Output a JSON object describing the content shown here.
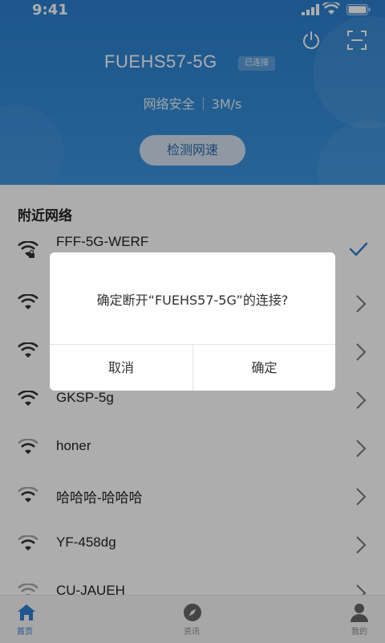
{
  "status_bar": {
    "time": "9:41"
  },
  "header": {
    "ssid": "FUEHS57-5G",
    "badge": "已连接",
    "security": "网络安全",
    "speed": "3M/s",
    "speed_test_button": "检测网速"
  },
  "nearby": {
    "title": "附近网络",
    "networks": [
      {
        "name": "FFF-5G-WERF",
        "locked": true,
        "connected": true
      },
      {
        "name": "",
        "locked": false,
        "connected": false
      },
      {
        "name": "",
        "locked": false,
        "connected": false
      },
      {
        "name": "GKSP-5g",
        "locked": false,
        "connected": false
      },
      {
        "name": "honer",
        "locked": false,
        "connected": false
      },
      {
        "name": "哈哈哈-哈哈哈",
        "locked": false,
        "connected": false
      },
      {
        "name": "YF-458dg",
        "locked": false,
        "connected": false
      },
      {
        "name": "CU-JAUEH",
        "locked": false,
        "connected": false
      }
    ]
  },
  "dialog": {
    "message": "确定断开“FUEHS57-5G”的连接?",
    "cancel": "取消",
    "confirm": "确定"
  },
  "tabbar": {
    "home": "首页",
    "news": "资讯",
    "mine": "我的"
  },
  "colors": {
    "header_blue": "#2a7fcf",
    "accent_blue": "#2f7fd1",
    "overlay": "rgba(0,0,0,0.32)"
  }
}
